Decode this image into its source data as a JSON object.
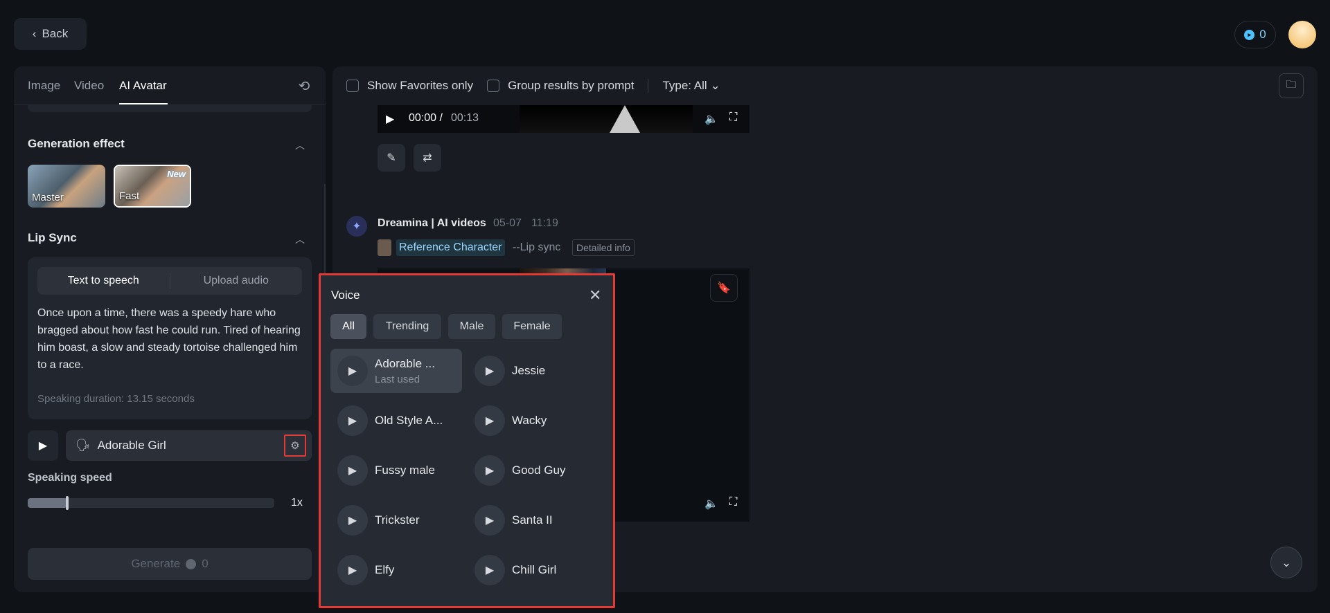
{
  "header": {
    "back_label": "Back",
    "credits": "0"
  },
  "left_panel": {
    "tabs": [
      {
        "label": "Image"
      },
      {
        "label": "Video"
      },
      {
        "label": "AI Avatar"
      }
    ],
    "generation_effect": {
      "title": "Generation effect",
      "options": [
        {
          "label": "Master"
        },
        {
          "label": "Fast",
          "badge": "New"
        }
      ]
    },
    "lip_sync": {
      "title": "Lip Sync",
      "segments": [
        "Text to speech",
        "Upload audio"
      ],
      "script": "Once upon a time, there was a speedy hare who bragged about how fast he could run. Tired of hearing him boast, a slow and steady tortoise challenged him to a race.",
      "duration": "Speaking duration: 13.15 seconds"
    },
    "voice": {
      "selected": "Adorable Girl"
    },
    "speaking_speed": {
      "label": "Speaking speed",
      "value": "1x",
      "level": 0.16
    },
    "generate": {
      "label": "Generate",
      "cost": "0"
    }
  },
  "right_panel": {
    "filters": {
      "favorites": "Show Favorites only",
      "group": "Group results by prompt",
      "type": "Type: All"
    },
    "video1": {
      "current": "00:00",
      "separator": " /",
      "total": "00:13"
    },
    "message": {
      "name": "Dreamina | AI videos",
      "date": "05-07",
      "time": "11:19",
      "ref": "Reference Character",
      "tag": "--Lip sync",
      "detail": "Detailed info"
    }
  },
  "voice_popup": {
    "title": "Voice",
    "filters": [
      "All",
      "Trending",
      "Male",
      "Female"
    ],
    "voices": [
      {
        "name": "Adorable ...",
        "sub": "Last used"
      },
      {
        "name": "Jessie"
      },
      {
        "name": "Old Style A..."
      },
      {
        "name": "Wacky"
      },
      {
        "name": "Fussy male"
      },
      {
        "name": "Good Guy"
      },
      {
        "name": "Trickster"
      },
      {
        "name": "Santa II"
      },
      {
        "name": "Elfy"
      },
      {
        "name": "Chill Girl"
      }
    ]
  },
  "colors": {
    "highlight_border": "#e53935",
    "accent": "#4cc3ff"
  }
}
